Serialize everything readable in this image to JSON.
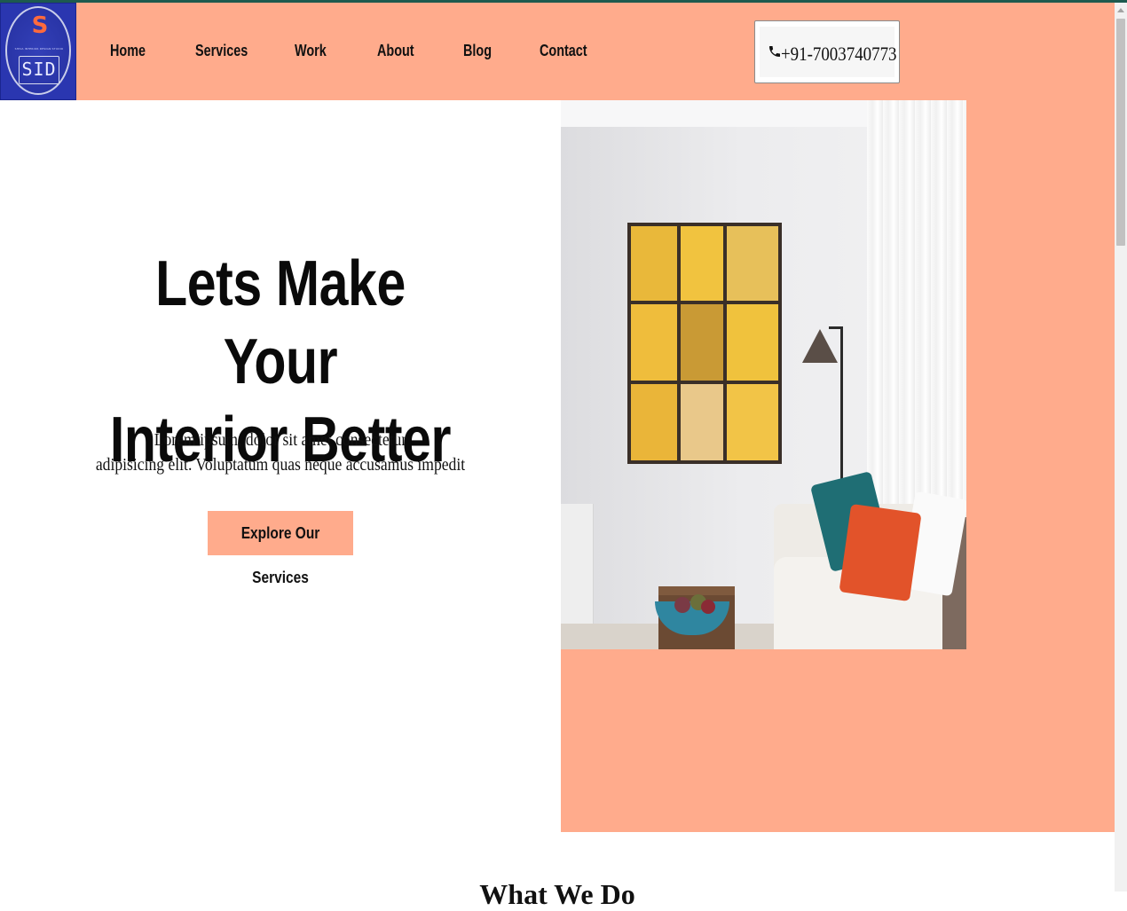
{
  "brand": {
    "logo_letter": "S",
    "logo_tagline": "SHIVA INTERIOR DESIGN STUDIO",
    "logo_text": "SID"
  },
  "nav": [
    {
      "label": "Home"
    },
    {
      "label": "Services"
    },
    {
      "label": "Work"
    },
    {
      "label": "About"
    },
    {
      "label": "Blog"
    },
    {
      "label": "Contact"
    }
  ],
  "contact": {
    "icon": "phone-icon",
    "phone": "+91-7003740773"
  },
  "hero": {
    "title_line1": "Lets Make Your",
    "title_line2": "Interior Better",
    "subtitle_line1": "Lorem ipsum, dolor sit amet consectetur",
    "subtitle_line2": "adipisicing elit. Voluptatum quas neque accusamus impedit",
    "cta_label": "Explore Our Services"
  },
  "next_section": {
    "title": "What We Do"
  },
  "colors": {
    "accent": "#ffab8c",
    "logo_bg": "#2a36b0",
    "top_line": "#1d5a4f"
  }
}
